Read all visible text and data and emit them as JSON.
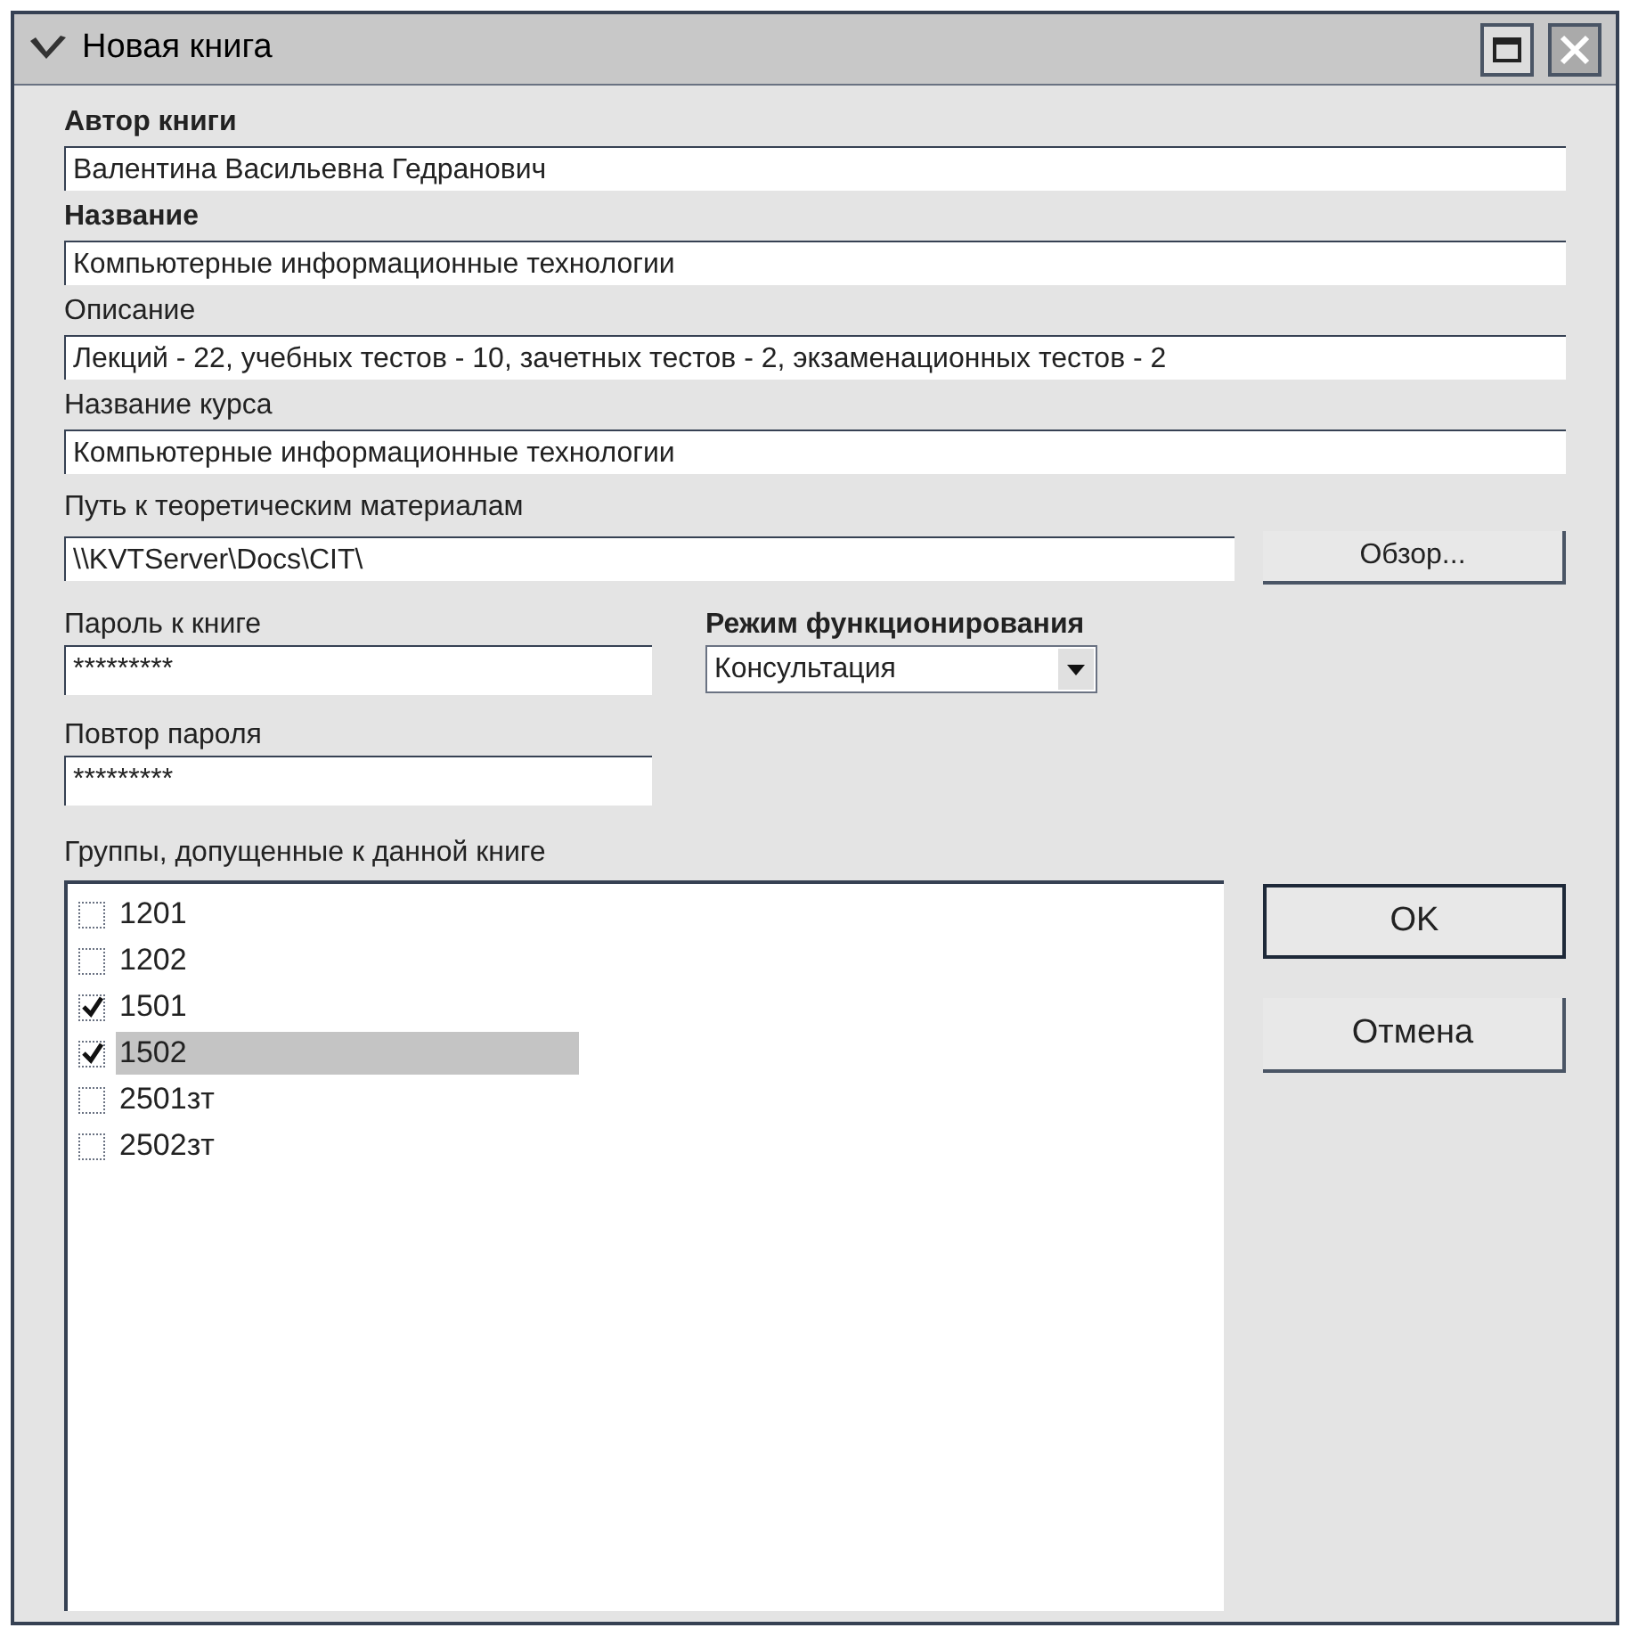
{
  "window": {
    "title": "Новая книга"
  },
  "fields": [
    {
      "label": "Автор книги",
      "bold": true,
      "value": "Валентина Васильевна Гедранович"
    },
    {
      "label": "Название",
      "bold": true,
      "value": "Компьютерные информационные технологии"
    },
    {
      "label": "Описание",
      "bold": false,
      "value": "Лекций - 22, учебных тестов - 10, зачетных тестов - 2, экзаменационных тестов - 2"
    },
    {
      "label": "Название курса",
      "bold": false,
      "value": "Компьютерные информационные технологии"
    }
  ],
  "path": {
    "label": "Путь к теоретическим материалам",
    "value": "\\\\KVTServer\\Docs\\CIT\\",
    "button": "Обзор..."
  },
  "password": {
    "label": "Пароль к книге",
    "value": "*********"
  },
  "mode": {
    "label": "Режим функционирования",
    "value": "Консультация"
  },
  "password_repeat": {
    "label": "Повтор пароля",
    "value": "*********"
  },
  "groups": {
    "label": "Группы, допущенные к данной книге",
    "items": [
      {
        "label": "1201",
        "checked": false,
        "selected": false
      },
      {
        "label": "1202",
        "checked": false,
        "selected": false
      },
      {
        "label": "1501",
        "checked": true,
        "selected": false
      },
      {
        "label": "1502",
        "checked": true,
        "selected": true
      },
      {
        "label": "2501зт",
        "checked": false,
        "selected": false
      },
      {
        "label": "2502зт",
        "checked": false,
        "selected": false
      }
    ]
  },
  "buttons": [
    {
      "label": "OK",
      "default": true
    },
    {
      "label": "Отмена",
      "default": false
    }
  ]
}
